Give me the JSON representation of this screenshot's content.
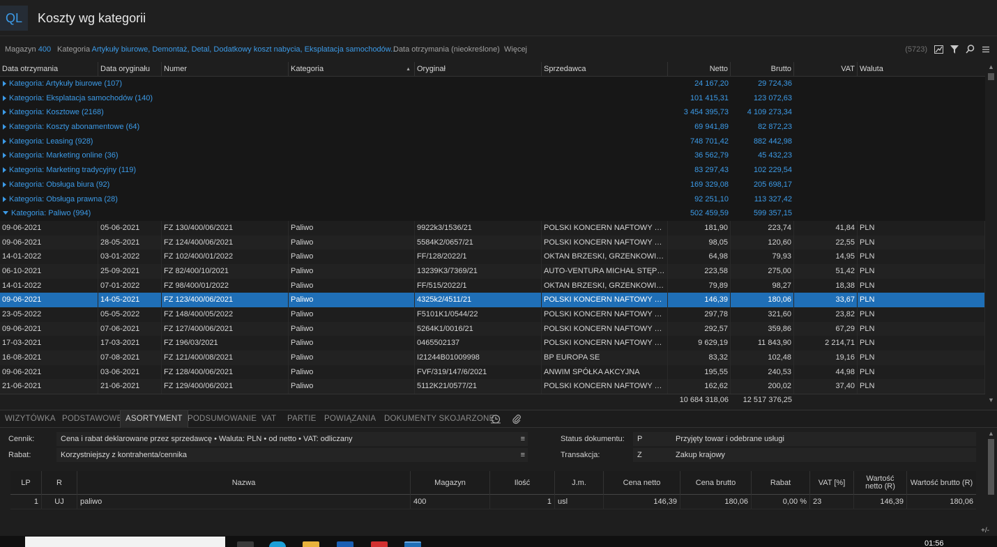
{
  "app": {
    "logo": "QL",
    "title": "Koszty wg kategorii"
  },
  "filters": {
    "magazyn_label": "Magazyn",
    "magazyn_value": "400",
    "kategoria_label": "Kategoria",
    "kategoria_value": "Artykuły biurowe, Demontaż, Detal, Dodatkowy koszt nabycia, Eksplatacja samochodów...",
    "data_label": "Data otrzymania (nieokreślone)",
    "more_label": "Więcej",
    "count": "(5723)"
  },
  "columns": [
    "Data otrzymania",
    "Data oryginału",
    "Numer",
    "Kategoria",
    "Oryginał",
    "Sprzedawca",
    "Netto",
    "Brutto",
    "VAT",
    "Waluta"
  ],
  "groups": [
    {
      "label": "Kategoria: Artykuły biurowe (107)",
      "netto": "24 167,20",
      "brutto": "29 724,36"
    },
    {
      "label": "Kategoria: Eksplatacja samochodów (140)",
      "netto": "101 415,31",
      "brutto": "123 072,63"
    },
    {
      "label": "Kategoria: Kosztowe (2168)",
      "netto": "3 454 395,73",
      "brutto": "4 109 273,34"
    },
    {
      "label": "Kategoria: Koszty abonamentowe (64)",
      "netto": "69 941,89",
      "brutto": "82 872,23"
    },
    {
      "label": "Kategoria: Leasing (928)",
      "netto": "748 701,42",
      "brutto": "882 442,98"
    },
    {
      "label": "Kategoria: Marketing online (36)",
      "netto": "36 562,79",
      "brutto": "45 432,23"
    },
    {
      "label": "Kategoria: Marketing tradycyjny (119)",
      "netto": "83 297,43",
      "brutto": "102 229,54"
    },
    {
      "label": "Kategoria: Obsługa biura (92)",
      "netto": "169 329,08",
      "brutto": "205 698,17"
    },
    {
      "label": "Kategoria: Obsługa prawna (28)",
      "netto": "92 251,10",
      "brutto": "113 327,42"
    }
  ],
  "open_group": {
    "label": "Kategoria: Paliwo (994)",
    "netto": "502 459,59",
    "brutto": "599 357,15"
  },
  "rows": [
    {
      "data_otrz": "09-06-2021",
      "data_oryg": "05-06-2021",
      "numer": "FZ 130/400/06/2021",
      "kategoria": "Paliwo",
      "oryginal": "9922k3/1536/21",
      "sprzedawca": "POLSKI KONCERN NAFTOWY ORLE...",
      "netto": "181,90",
      "brutto": "223,74",
      "vat": "41,84",
      "waluta": "PLN"
    },
    {
      "data_otrz": "09-06-2021",
      "data_oryg": "28-05-2021",
      "numer": "FZ 124/400/06/2021",
      "kategoria": "Paliwo",
      "oryginal": "5584K2/0657/21",
      "sprzedawca": "POLSKI KONCERN NAFTOWY ORLE...",
      "netto": "98,05",
      "brutto": "120,60",
      "vat": "22,55",
      "waluta": "PLN"
    },
    {
      "data_otrz": "14-01-2022",
      "data_oryg": "03-01-2022",
      "numer": "FZ 102/400/01/2022",
      "kategoria": "Paliwo",
      "oryginal": "FF/128/2022/1",
      "sprzedawca": "OKTAN BRZESKI, GRZENKOWICZ S...",
      "netto": "64,98",
      "brutto": "79,93",
      "vat": "14,95",
      "waluta": "PLN"
    },
    {
      "data_otrz": "06-10-2021",
      "data_oryg": "25-09-2021",
      "numer": "FZ 82/400/10/2021",
      "kategoria": "Paliwo",
      "oryginal": "13239K3/7369/21",
      "sprzedawca": "AUTO-VENTURA MICHAŁ STĘPNIE...",
      "netto": "223,58",
      "brutto": "275,00",
      "vat": "51,42",
      "waluta": "PLN"
    },
    {
      "data_otrz": "14-01-2022",
      "data_oryg": "07-01-2022",
      "numer": "FZ 98/400/01/2022",
      "kategoria": "Paliwo",
      "oryginal": "FF/515/2022/1",
      "sprzedawca": "OKTAN BRZESKI, GRZENKOWICZ S...",
      "netto": "79,89",
      "brutto": "98,27",
      "vat": "18,38",
      "waluta": "PLN"
    },
    {
      "data_otrz": "09-06-2021",
      "data_oryg": "14-05-2021",
      "numer": "FZ 123/400/06/2021",
      "kategoria": "Paliwo",
      "oryginal": "4325k2/4511/21",
      "sprzedawca": "POLSKI KONCERN NAFTOWY ORLE...",
      "netto": "146,39",
      "brutto": "180,06",
      "vat": "33,67",
      "waluta": "PLN",
      "selected": true
    },
    {
      "data_otrz": "23-05-2022",
      "data_oryg": "05-05-2022",
      "numer": "FZ 148/400/05/2022",
      "kategoria": "Paliwo",
      "oryginal": "F5101K1/0544/22",
      "sprzedawca": "POLSKI KONCERN NAFTOWY ORLE...",
      "netto": "297,78",
      "brutto": "321,60",
      "vat": "23,82",
      "waluta": "PLN"
    },
    {
      "data_otrz": "09-06-2021",
      "data_oryg": "07-06-2021",
      "numer": "FZ 127/400/06/2021",
      "kategoria": "Paliwo",
      "oryginal": "5264K1/0016/21",
      "sprzedawca": "POLSKI KONCERN NAFTOWY ORLE...",
      "netto": "292,57",
      "brutto": "359,86",
      "vat": "67,29",
      "waluta": "PLN"
    },
    {
      "data_otrz": "17-03-2021",
      "data_oryg": "17-03-2021",
      "numer": "FZ 196/03/2021",
      "kategoria": "Paliwo",
      "oryginal": "0465502137",
      "sprzedawca": "POLSKI KONCERN NAFTOWY ORLE...",
      "netto": "9 629,19",
      "brutto": "11 843,90",
      "vat": "2 214,71",
      "waluta": "PLN"
    },
    {
      "data_otrz": "16-08-2021",
      "data_oryg": "07-08-2021",
      "numer": "FZ 121/400/08/2021",
      "kategoria": "Paliwo",
      "oryginal": "I21244B01009998",
      "sprzedawca": "BP EUROPA SE",
      "netto": "83,32",
      "brutto": "102,48",
      "vat": "19,16",
      "waluta": "PLN"
    },
    {
      "data_otrz": "09-06-2021",
      "data_oryg": "03-06-2021",
      "numer": "FZ 128/400/06/2021",
      "kategoria": "Paliwo",
      "oryginal": "FVF/319/147/6/2021",
      "sprzedawca": "ANWIM SPÓŁKA AKCYJNA",
      "netto": "195,55",
      "brutto": "240,53",
      "vat": "44,98",
      "waluta": "PLN"
    },
    {
      "data_otrz": "21-06-2021",
      "data_oryg": "21-06-2021",
      "numer": "FZ 129/400/06/2021",
      "kategoria": "Paliwo",
      "oryginal": "5112K21/0577/21",
      "sprzedawca": "POLSKI KONCERN NAFTOWY ORLE...",
      "netto": "162,62",
      "brutto": "200,02",
      "vat": "37,40",
      "waluta": "PLN"
    }
  ],
  "totals": {
    "netto": "10 684 318,06",
    "brutto": "12 517 376,25"
  },
  "tabs": [
    "WIZYTÓWKA",
    "PODSTAWOWE",
    "ASORTYMENT",
    "PODSUMOWANIE",
    "VAT",
    "PARTIE",
    "POWIĄZANIA",
    "DOKUMENTY SKOJARZONE"
  ],
  "active_tab": "ASORTYMENT",
  "form": {
    "cennik_label": "Cennik:",
    "cennik_value": "Cena i rabat deklarowane przez sprzedawcę • Waluta: PLN • od netto • VAT: odliczany",
    "rabat_label": "Rabat:",
    "rabat_value": "Korzystniejszy z kontrahenta/cennika",
    "status_label": "Status dokumentu:",
    "status_code": "P",
    "status_value": "Przyjęty towar i odebrane usługi",
    "transakcja_label": "Transakcja:",
    "transakcja_code": "Z",
    "transakcja_value": "Zakup krajowy"
  },
  "item_columns": [
    "LP",
    "R",
    "Nazwa",
    "Magazyn",
    "Ilość",
    "J.m.",
    "Cena netto",
    "Cena brutto",
    "Rabat",
    "VAT [%]",
    "Wartość netto (R)",
    "Wartość brutto (R)"
  ],
  "items": [
    {
      "lp": "1",
      "r": "UJ",
      "nazwa": "paliwo",
      "magazyn": "400",
      "ilosc": "1",
      "jm": "usl",
      "cena_netto": "146,39",
      "cena_brutto": "180,06",
      "rabat": "0,00 %",
      "vat": "23",
      "wartosc_netto": "146,39",
      "wartosc_brutto": "180,06"
    }
  ],
  "plusminus": "+/-",
  "taskbar": {
    "clock": "01:56"
  },
  "colors": {
    "accent": "#3c9be8",
    "selection": "#1f6fb7",
    "background": "#1e1e1e"
  }
}
